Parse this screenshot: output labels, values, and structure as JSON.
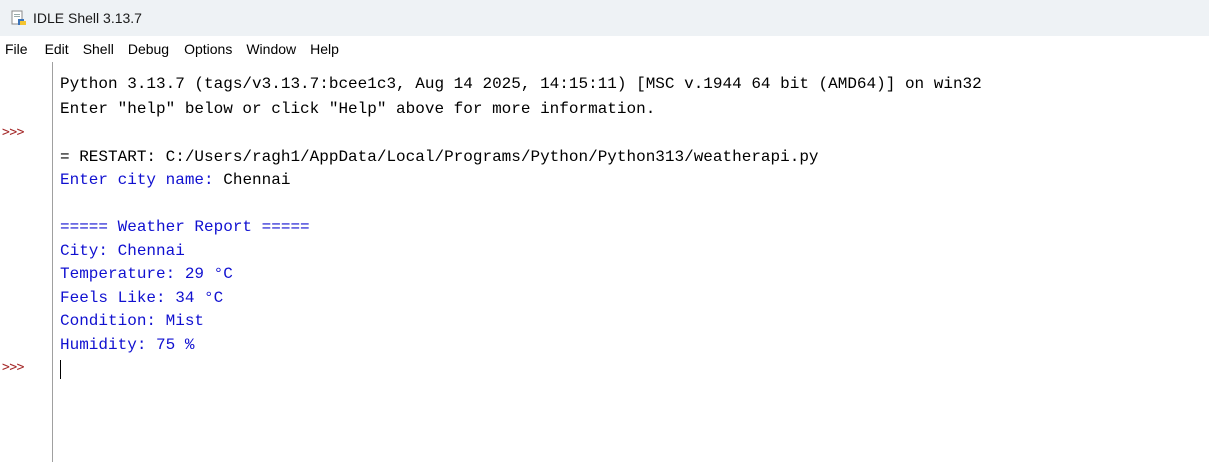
{
  "window": {
    "title": "IDLE Shell 3.13.7"
  },
  "menu": [
    "File",
    "Edit",
    "Shell",
    "Debug",
    "Options",
    "Window",
    "Help"
  ],
  "prompts": [
    ">>>",
    ">>>"
  ],
  "shell": {
    "banner_line1": "Python 3.13.7 (tags/v3.13.7:bcee1c3, Aug 14 2025, 14:15:11) [MSC v.1944 64 bit (AMD64)] on win32",
    "banner_line2": "Enter \"help\" below or click \"Help\" above for more information.",
    "restart_line": "= RESTART: C:/Users/ragh1/AppData/Local/Programs/Python/Python313/weatherapi.py",
    "input_prompt": "Enter city name: ",
    "input_value": "Chennai",
    "report_header": "===== Weather Report =====",
    "city": "City: Chennai",
    "temperature": "Temperature: 29 °C",
    "feels_like": "Feels Like: 34 °C",
    "condition": "Condition: Mist",
    "humidity": "Humidity: 75 %"
  },
  "colors": {
    "stdout": "#1010d0",
    "stdin": "#000000",
    "prompt": "#a52a2a"
  },
  "icons": {
    "app_icon": "python-idle-icon"
  }
}
